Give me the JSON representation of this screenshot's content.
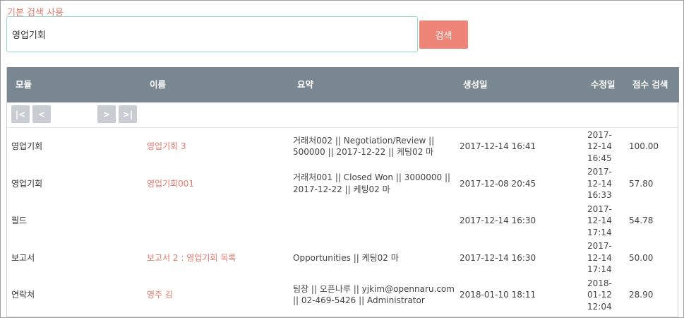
{
  "search": {
    "label": "기본 검색 사용",
    "value": "영업기회",
    "button_label": "검색"
  },
  "table": {
    "columns": [
      "모듈",
      "이름",
      "요약",
      "생성일",
      "수정일",
      "점수 검색"
    ],
    "pager": {
      "first": "|<",
      "prev": "<",
      "next": ">",
      "last": ">|"
    },
    "rows": [
      {
        "module": "영업기회",
        "name": "영업기회 3",
        "summary": "거래처002 || Negotiation/Review || 500000 || 2017-12-22 || 케팅02 마",
        "created": "2017-12-14 16:41",
        "modified": "2017-12-14 16:45",
        "score": "100.00"
      },
      {
        "module": "영업기회",
        "name": "영업기회001",
        "summary": "거래처001 || Closed Won || 3000000 || 2017-12-22 || 케팅02 마",
        "created": "2017-12-08 20:45",
        "modified": "2017-12-14 16:33",
        "score": "57.80"
      },
      {
        "module": "필드",
        "name": "",
        "summary": "",
        "created": "2017-12-14 16:30",
        "modified": "2017-12-14 17:14",
        "score": "54.78"
      },
      {
        "module": "보고서",
        "name": "보고서 2 : 영업기회 목록",
        "summary": "Opportunities || 케팅02 마",
        "created": "2017-12-14 16:30",
        "modified": "2017-12-14 17:14",
        "score": "50.00"
      },
      {
        "module": "연락처",
        "name": "영주 김",
        "summary": "팀장 || 오픈나루 || yjkim@opennaru.com || 02-469-5426 || Administrator",
        "created": "2018-01-10 18:11",
        "modified": "2018-01-12 12:04",
        "score": "28.90"
      }
    ]
  },
  "colors": {
    "accent": "#ef8478",
    "link": "#e8796b",
    "header_bg": "#798791",
    "input_border": "#8fd9c9",
    "pager_bg": "#c7cdd3"
  }
}
